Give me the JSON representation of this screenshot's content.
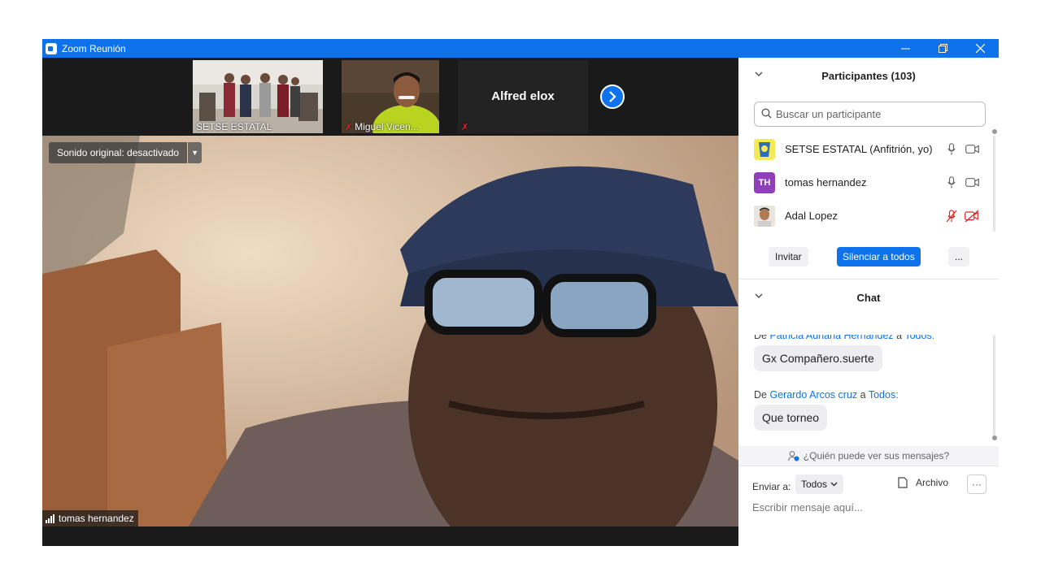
{
  "window": {
    "title": "Zoom Reunión"
  },
  "thumbnails": [
    {
      "name": "SETSE ESTATAL",
      "muted": false
    },
    {
      "name": "Miguel Vicen...",
      "muted": true
    },
    {
      "name": "Alfred elox",
      "muted": true
    }
  ],
  "main_video": {
    "audio_status": "Sonido original: desactivado",
    "speaker_name": "tomas hernandez"
  },
  "participants_panel": {
    "title": "Participantes (103)",
    "search_placeholder": "Buscar un participante",
    "items": [
      {
        "name": "SETSE ESTATAL (Anfitrión, yo)",
        "initials": "",
        "mic": "on",
        "video": "on",
        "avatar_color": "#f2e64a"
      },
      {
        "name": "tomas hernandez",
        "initials": "TH",
        "mic": "on",
        "video": "on",
        "avatar_color": "#8f3fb8"
      },
      {
        "name": "Adal Lopez",
        "initials": "",
        "mic": "muted",
        "video": "off",
        "avatar_color": "#c8a27c"
      }
    ],
    "invite_label": "Invitar",
    "mute_all_label": "Silenciar a todos",
    "more_label": "..."
  },
  "chat_panel": {
    "title": "Chat",
    "messages": [
      {
        "prefix": "De",
        "sender": "Patricia Adriana Hernandez",
        "connector": "a",
        "recipient": "Todos:",
        "text": "Gx Compañero.suerte"
      },
      {
        "prefix": "De",
        "sender": "Gerardo Arcos cruz",
        "connector": "a",
        "recipient": "Todos:",
        "text": "Que torneo"
      }
    ],
    "who_can_see": "¿Quién puede ver sus mensajes?",
    "send_to_label": "Enviar a:",
    "send_to_value": "Todos",
    "file_label": "Archivo",
    "more_label": "···",
    "input_placeholder": "Escribir mensaje aquí..."
  },
  "colors": {
    "accent": "#0e72ed",
    "muted_red": "#e02828"
  }
}
